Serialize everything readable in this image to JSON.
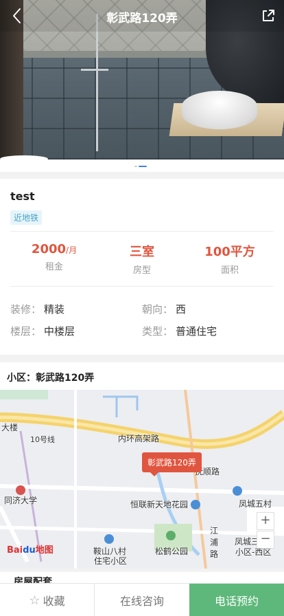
{
  "header": {
    "title": "彰武路120弄"
  },
  "gallery": {
    "dot_count": 2,
    "active_index": 1
  },
  "listing": {
    "name": "test",
    "tag": "近地铁",
    "stats": [
      {
        "value": "2000",
        "unit": "/月",
        "label": "租金"
      },
      {
        "value": "三室",
        "unit": "",
        "label": "房型"
      },
      {
        "value": "100平方",
        "unit": "",
        "label": "面积"
      }
    ],
    "details": [
      {
        "key": "装修：",
        "value": "精装"
      },
      {
        "key": "朝向：",
        "value": "西"
      },
      {
        "key": "楼层：",
        "value": "中楼层"
      },
      {
        "key": "类型：",
        "value": "普通住宅"
      }
    ]
  },
  "community": {
    "heading": "小区：彰武路120弄",
    "map": {
      "marker_label": "彰武路120弄",
      "labels": [
        "内环高架路",
        "10号线",
        "同济大学",
        "恒联新天地花园",
        "凤城五村",
        "鞍山八村",
        "住宅小区",
        "松鹤公园",
        "江浦路",
        "凤城三村",
        "小区-西区",
        "抚顺路",
        "大楼"
      ],
      "zoom_in": "+",
      "zoom_out": "−",
      "logo_bai": "Bai",
      "logo_du": "du",
      "logo_map": "地图"
    }
  },
  "config_section_title": "房屋配套",
  "bottom_bar": {
    "favorite": "收藏",
    "consult": "在线咨询",
    "call": "电话预约"
  },
  "colors": {
    "accent_red": "#e0553f",
    "call_green": "#5fb87b",
    "tag_blue": "#4aa3c8",
    "dot_active": "#3b82f6"
  }
}
